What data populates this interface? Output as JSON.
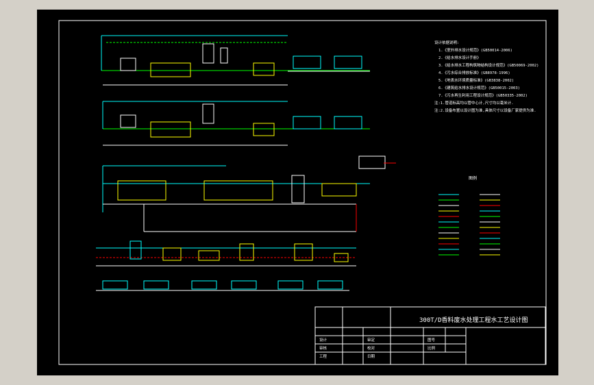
{
  "drawing": {
    "title": "300T/D香料废水处理工程水工艺设计图",
    "title_block": {
      "labels": [
        "设计",
        "审核",
        "工程",
        "审定",
        "校对",
        "日期",
        "图号",
        "比例"
      ]
    },
    "notes": {
      "heading": "设计依据说明:",
      "lines": [
        "1.《室外排水设计规范》(GB50014-2006)",
        "2.《给水排水设计手册》",
        "3.《给水排水工程构筑物结构设计规范》(GB50069-2002)",
        "4.《污水综合排放标准》(GB8978-1996)",
        "5.《地表水环境质量标准》(GB3838-2002)",
        "6.《建筑给水排水设计规范》(GB50015-2003)",
        "7.《污水再生利用工程设计规范》(GB50335-2002)",
        "注:1.管道标高均以管中心计,尺寸均以毫米计.",
        "注:2.设备布置以设计图为准,具体尺寸以设备厂家提供为准."
      ]
    },
    "legend": {
      "heading": "图例"
    },
    "colors": {
      "background": "#000000",
      "frame": "#ffffff",
      "pipe_green": "#00ff00",
      "structure_cyan": "#00ffff",
      "equipment_yellow": "#ffff00",
      "sludge_red": "#ff0000",
      "outline_white": "#ffffff",
      "frame_gray": "#d4d0c8"
    }
  }
}
